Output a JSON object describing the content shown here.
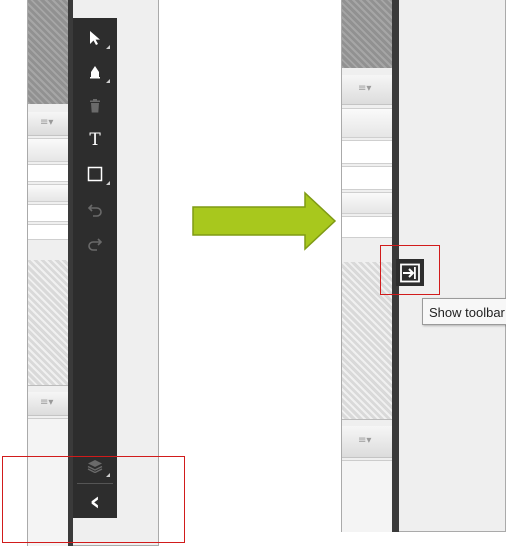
{
  "colors": {
    "toolbar_bg": "#2d2d2d",
    "highlight_red": "#d11b1b",
    "arrow_green": "#a8c81d"
  },
  "left_panel": {
    "toolbar": {
      "tools": [
        {
          "name": "select-tool",
          "icon": "cursor-arrow-icon"
        },
        {
          "name": "fill-tool",
          "icon": "paint-bucket-icon"
        },
        {
          "name": "delete-tool",
          "icon": "trash-icon"
        },
        {
          "name": "text-tool",
          "icon": "text-T-icon",
          "glyph": "T"
        },
        {
          "name": "shape-tool",
          "icon": "rectangle-icon"
        },
        {
          "name": "undo-tool",
          "icon": "undo-icon"
        },
        {
          "name": "redo-tool",
          "icon": "redo-icon"
        }
      ],
      "layers_icon": "layers-icon",
      "collapse_icon": "chevron-left-icon",
      "collapse_glyph": "‹"
    },
    "dropdown_glyph": "≡▾"
  },
  "right_panel": {
    "dropdown_glyph": "≡▾",
    "show_toolbar_icon": "expand-panel-icon",
    "tooltip": "Show toolbar"
  },
  "arrow": {
    "icon": "right-arrow-icon"
  }
}
